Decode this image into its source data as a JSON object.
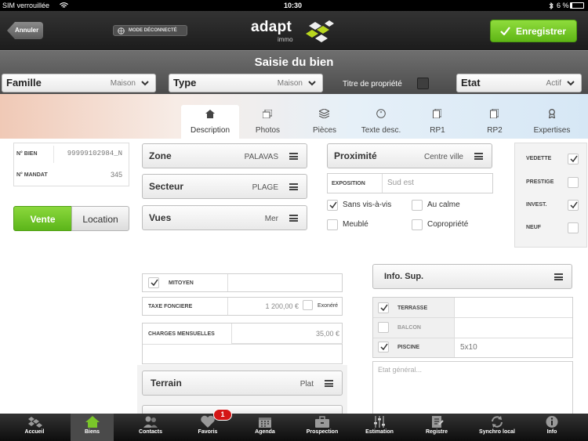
{
  "status": {
    "carrier": "SIM verrouillée",
    "time": "10:30",
    "battery": "6 %"
  },
  "header": {
    "cancel": "Annuler",
    "offline": "MODE DÉCONNECTÉ",
    "brand": "adapt",
    "brand_sub": "immo",
    "save": "Enregistrer",
    "title": "Saisie du bien"
  },
  "filters": {
    "famille_label": "Famille",
    "famille_value": "Maison",
    "type_label": "Type",
    "type_value": "Maison",
    "titre": "Titre de propriété",
    "etat_label": "Etat",
    "etat_value": "Actif"
  },
  "tabs": [
    "Description",
    "Photos",
    "Pièces",
    "Texte desc.",
    "RP1",
    "RP2",
    "Expertises"
  ],
  "ids": {
    "bien_label": "N° BIEN",
    "bien_value": "99999102984_N",
    "mandat_label": "N° MANDAT",
    "mandat_value": "345"
  },
  "mode": {
    "vente": "Vente",
    "location": "Location"
  },
  "zone": {
    "label": "Zone",
    "value": "PALAVAS"
  },
  "secteur": {
    "label": "Secteur",
    "value": "PLAGE"
  },
  "vues": {
    "label": "Vues",
    "value": "Mer"
  },
  "proximite": {
    "label": "Proximité",
    "value": "Centre ville"
  },
  "exposition": {
    "label": "EXPOSITION",
    "placeholder": "Sud est"
  },
  "options": {
    "sans_vis": "Sans vis-à-vis",
    "au_calme": "Au calme",
    "meuble": "Meublé",
    "copro": "Copropriété"
  },
  "flags": {
    "vedette": "VEDETTE",
    "prestige": "PRESTIGE",
    "invest": "INVEST.",
    "neuf": "NEUF"
  },
  "mitoyen": "MITOYEN",
  "taxe": {
    "label": "TAXE FONCIERE",
    "value": "1 200,00 €",
    "exonere": "Exonéré"
  },
  "charges": {
    "label": "CHARGES MENSUELLES",
    "value": "35,00 €"
  },
  "terrain": {
    "label": "Terrain",
    "value": "Plat"
  },
  "info": {
    "title": "Info. Sup.",
    "terrasse": "TERRASSE",
    "balcon": "BALCON",
    "piscine": "PISCINE",
    "piscine_value": "5x10",
    "etat_placeholder": "Etat général..."
  },
  "tabbar": [
    "Accueil",
    "Biens",
    "Contacts",
    "Favoris",
    "Agenda",
    "Prospection",
    "Estimation",
    "Registre",
    "Synchro local",
    "Info"
  ],
  "badge": "1",
  "colors": {
    "green": "#6cc51a",
    "dark": "#2a2a2a"
  }
}
